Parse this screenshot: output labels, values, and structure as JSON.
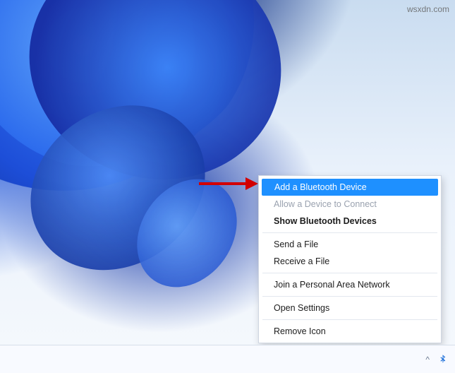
{
  "watermark": "wsxdn.com",
  "contextMenu": {
    "items": [
      {
        "id": "add-bt-device",
        "label": "Add a Bluetooth Device",
        "state": "highlighted"
      },
      {
        "id": "allow-connect",
        "label": "Allow a Device to Connect",
        "state": "disabled"
      },
      {
        "id": "show-bt",
        "label": "Show Bluetooth Devices",
        "state": "bold"
      },
      {
        "sep": true
      },
      {
        "id": "send-file",
        "label": "Send a File",
        "state": "normal"
      },
      {
        "id": "receive-file",
        "label": "Receive a File",
        "state": "normal"
      },
      {
        "sep": true
      },
      {
        "id": "join-pan",
        "label": "Join a Personal Area Network",
        "state": "normal"
      },
      {
        "sep": true
      },
      {
        "id": "open-settings",
        "label": "Open Settings",
        "state": "normal"
      },
      {
        "sep": true
      },
      {
        "id": "remove-icon",
        "label": "Remove Icon",
        "state": "normal"
      }
    ]
  },
  "taskbar": {
    "tray_chevron": "^",
    "bluetooth_icon_name": "bluetooth-icon"
  }
}
